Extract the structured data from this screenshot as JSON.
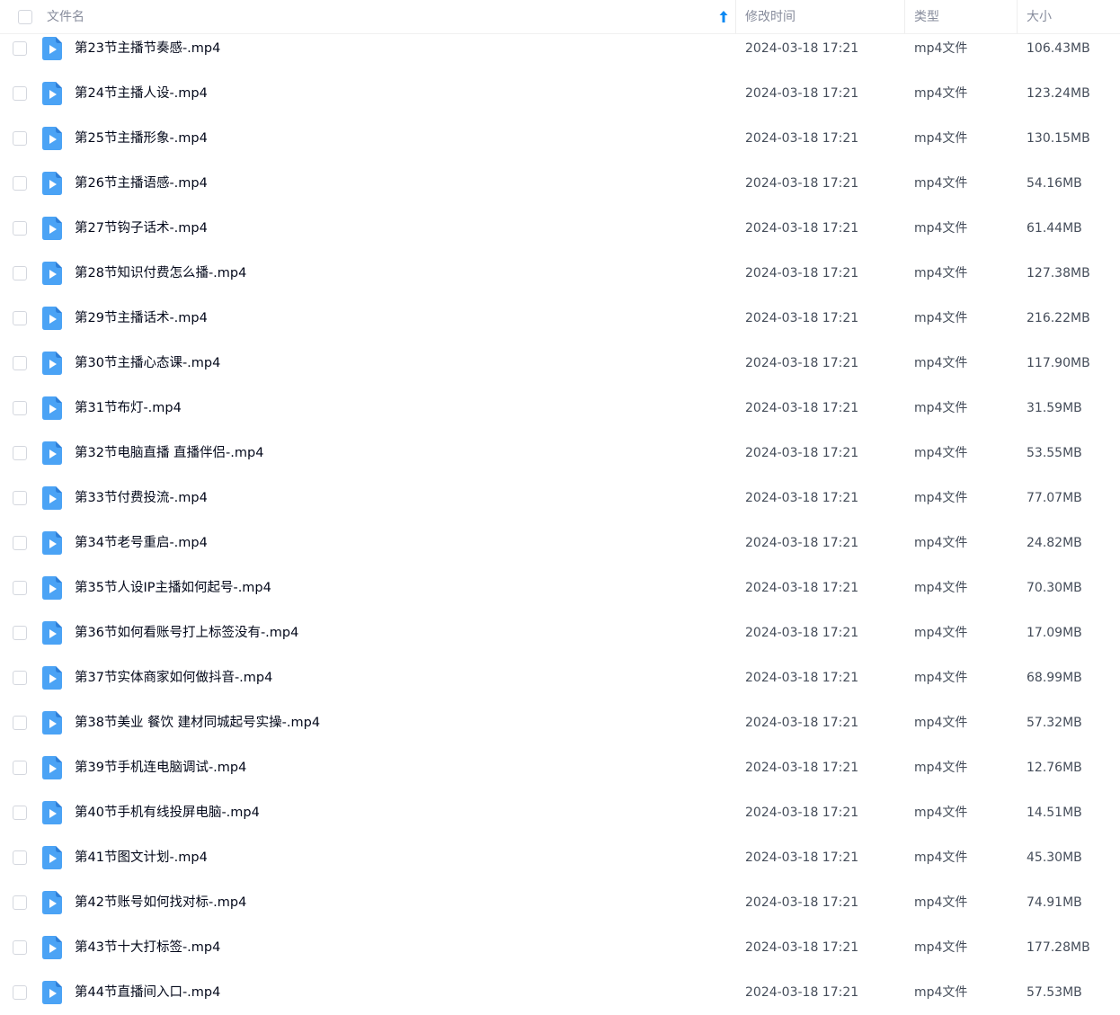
{
  "header": {
    "name_label": "文件名",
    "time_label": "修改时间",
    "type_label": "类型",
    "size_label": "大小"
  },
  "colors": {
    "icon_blue": "#4ba3f5",
    "icon_fold": "#2d7fd9",
    "sort_arrow": "#0d89f2"
  },
  "rows": [
    {
      "name": "第23节主播节奏感-.mp4",
      "time": "2024-03-18 17:21",
      "type": "mp4文件",
      "size": "106.43MB"
    },
    {
      "name": "第24节主播人设-.mp4",
      "time": "2024-03-18 17:21",
      "type": "mp4文件",
      "size": "123.24MB"
    },
    {
      "name": "第25节主播形象-.mp4",
      "time": "2024-03-18 17:21",
      "type": "mp4文件",
      "size": "130.15MB"
    },
    {
      "name": "第26节主播语感-.mp4",
      "time": "2024-03-18 17:21",
      "type": "mp4文件",
      "size": "54.16MB"
    },
    {
      "name": "第27节钩子话术-.mp4",
      "time": "2024-03-18 17:21",
      "type": "mp4文件",
      "size": "61.44MB"
    },
    {
      "name": "第28节知识付费怎么播-.mp4",
      "time": "2024-03-18 17:21",
      "type": "mp4文件",
      "size": "127.38MB"
    },
    {
      "name": "第29节主播话术-.mp4",
      "time": "2024-03-18 17:21",
      "type": "mp4文件",
      "size": "216.22MB"
    },
    {
      "name": "第30节主播心态课-.mp4",
      "time": "2024-03-18 17:21",
      "type": "mp4文件",
      "size": "117.90MB"
    },
    {
      "name": "第31节布灯-.mp4",
      "time": "2024-03-18 17:21",
      "type": "mp4文件",
      "size": "31.59MB"
    },
    {
      "name": "第32节电脑直播  直播伴侣-.mp4",
      "time": "2024-03-18 17:21",
      "type": "mp4文件",
      "size": "53.55MB"
    },
    {
      "name": "第33节付费投流-.mp4",
      "time": "2024-03-18 17:21",
      "type": "mp4文件",
      "size": "77.07MB"
    },
    {
      "name": "第34节老号重启-.mp4",
      "time": "2024-03-18 17:21",
      "type": "mp4文件",
      "size": "24.82MB"
    },
    {
      "name": "第35节人设IP主播如何起号-.mp4",
      "time": "2024-03-18 17:21",
      "type": "mp4文件",
      "size": "70.30MB"
    },
    {
      "name": "第36节如何看账号打上标签没有-.mp4",
      "time": "2024-03-18 17:21",
      "type": "mp4文件",
      "size": "17.09MB"
    },
    {
      "name": "第37节实体商家如何做抖音-.mp4",
      "time": "2024-03-18 17:21",
      "type": "mp4文件",
      "size": "68.99MB"
    },
    {
      "name": "第38节美业 餐饮 建材同城起号实操-.mp4",
      "time": "2024-03-18 17:21",
      "type": "mp4文件",
      "size": "57.32MB"
    },
    {
      "name": "第39节手机连电脑调试-.mp4",
      "time": "2024-03-18 17:21",
      "type": "mp4文件",
      "size": "12.76MB"
    },
    {
      "name": "第40节手机有线投屏电脑-.mp4",
      "time": "2024-03-18 17:21",
      "type": "mp4文件",
      "size": "14.51MB"
    },
    {
      "name": "第41节图文计划-.mp4",
      "time": "2024-03-18 17:21",
      "type": "mp4文件",
      "size": "45.30MB"
    },
    {
      "name": "第42节账号如何找对标-.mp4",
      "time": "2024-03-18 17:21",
      "type": "mp4文件",
      "size": "74.91MB"
    },
    {
      "name": "第43节十大打标签-.mp4",
      "time": "2024-03-18 17:21",
      "type": "mp4文件",
      "size": "177.28MB"
    },
    {
      "name": "第44节直播间入口-.mp4",
      "time": "2024-03-18 17:21",
      "type": "mp4文件",
      "size": "57.53MB"
    }
  ]
}
